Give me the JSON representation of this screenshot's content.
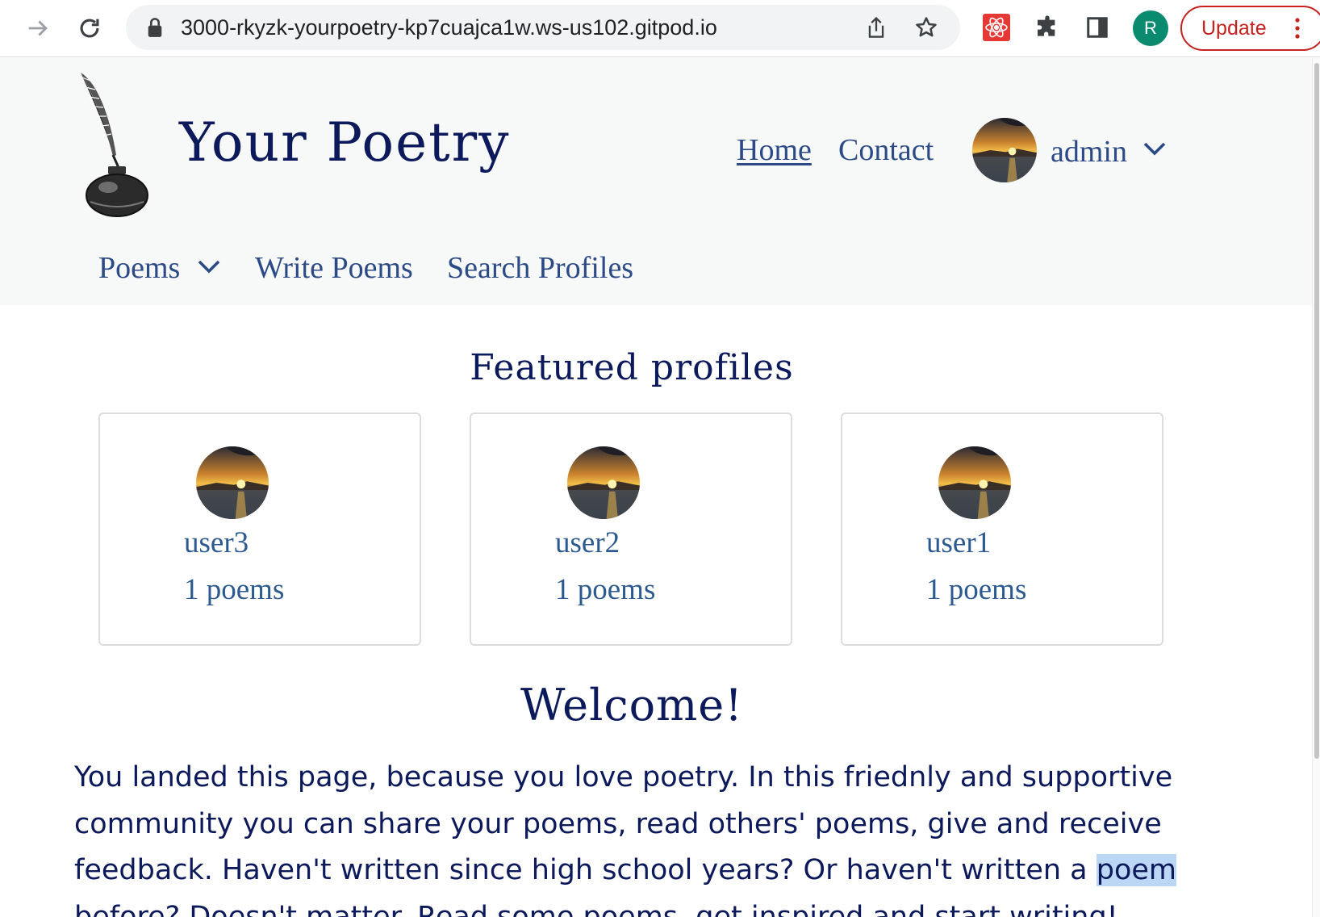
{
  "browser": {
    "url": "3000-rkyzk-yourpoetry-kp7cuajca1w.ws-us102.gitpod.io",
    "profile_initial": "R",
    "update_label": "Update",
    "icons": [
      "forward-icon",
      "reload-icon",
      "lock-icon",
      "share-icon",
      "bookmark-star-icon",
      "react-devtools-icon",
      "extensions-puzzle-icon",
      "side-panel-icon",
      "more-menu-icon"
    ]
  },
  "site": {
    "brand": "Your Poetry",
    "nav": {
      "home": "Home",
      "contact": "Contact"
    },
    "user": {
      "name": "admin"
    },
    "subnav": {
      "poems": "Poems",
      "write": "Write Poems",
      "search": "Search Profiles"
    }
  },
  "featured": {
    "title": "Featured profiles",
    "profiles": [
      {
        "name": "user3",
        "count": "1 poems"
      },
      {
        "name": "user2",
        "count": "1 poems"
      },
      {
        "name": "user1",
        "count": "1 poems"
      }
    ]
  },
  "welcome": {
    "title": "Welcome!",
    "text_before": "You landed this page, because you love poetry. In this friednly and supportive community you can share your poems, read others' poems, give and receive feedback. Haven't written since high school years? Or haven't written a ",
    "text_highlight": "poem",
    "text_after": " before? Doesn't matter. Read some poems, get inspired and start writing!"
  },
  "colors": {
    "brand_navy": "#0c1a5c",
    "link_blue": "#2c4a86",
    "header_bg": "#f7f8f8",
    "update_red": "#c5221f",
    "profile_green": "#0a8a6e",
    "selection": "#bcd6f5"
  }
}
